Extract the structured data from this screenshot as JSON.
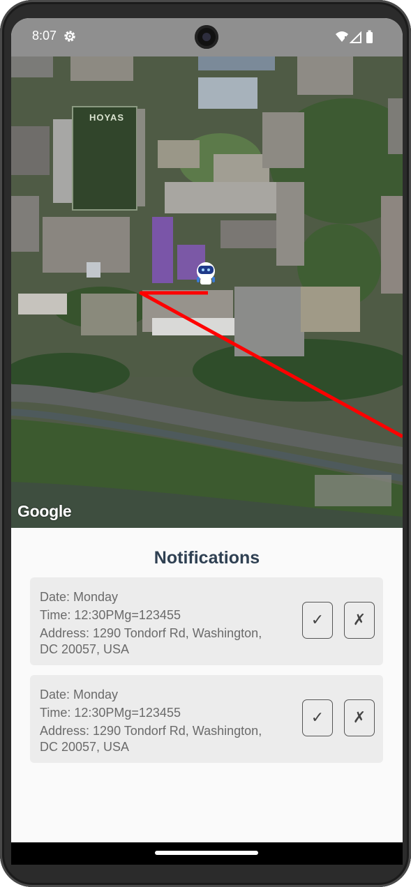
{
  "status_bar": {
    "time": "8:07",
    "icons": [
      "gear-icon",
      "wifi-icon",
      "signal-icon",
      "battery-icon"
    ]
  },
  "map": {
    "provider_logo": "Google",
    "field_text": "HOYAS",
    "route_color": "#ff0000",
    "marker_icon": "robot-marker-icon"
  },
  "notifications": {
    "title": "Notifications",
    "items": [
      {
        "date": "Date: Monday",
        "time": "Time: 12:30PMg=123455",
        "address": "Address: 1290 Tondorf Rd, Washington, DC 20057, USA",
        "accept_label": "✓",
        "reject_label": "✗"
      },
      {
        "date": "Date: Monday",
        "time": "Time: 12:30PMg=123455",
        "address": "Address: 1290 Tondorf Rd, Washington, DC 20057, USA",
        "accept_label": "✓",
        "reject_label": "✗"
      }
    ]
  },
  "colors": {
    "title": "#2f4052",
    "card_bg": "#ececec",
    "status_bar": "#8f8f8f"
  }
}
